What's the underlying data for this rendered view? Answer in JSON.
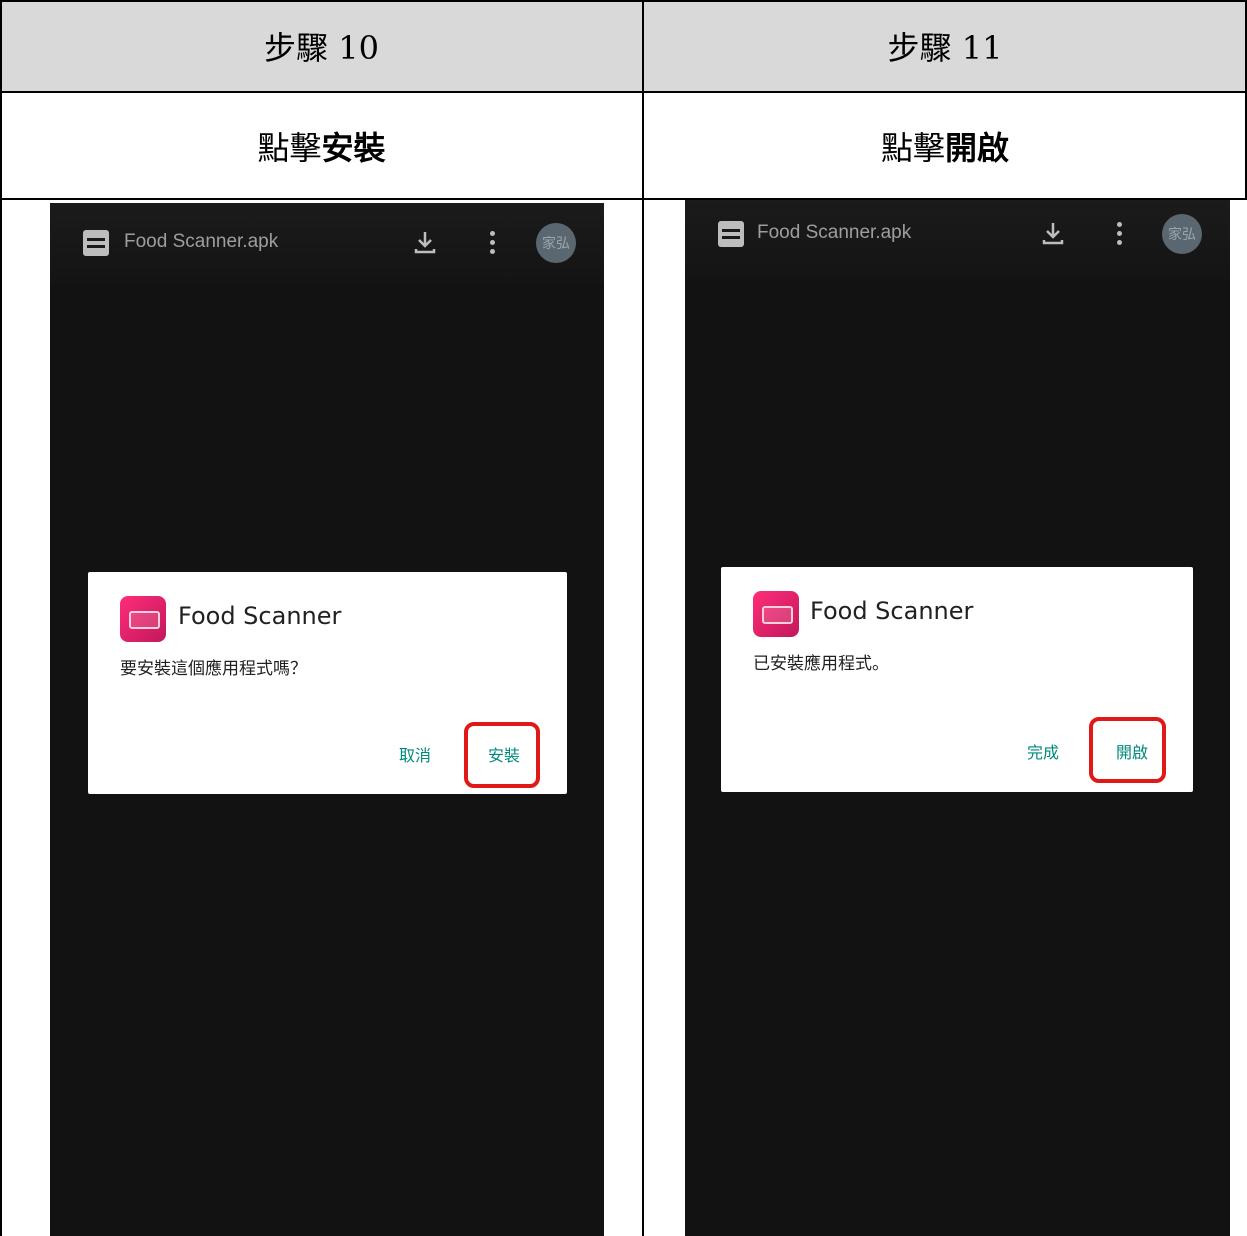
{
  "steps": [
    {
      "header": "步驟 10",
      "instruction_prefix": "點擊",
      "instruction_action": "安裝",
      "phone": {
        "file_name": "Food Scanner.apk",
        "avatar_text": "家弘",
        "app_name": "Food Scanner",
        "message": "要安裝這個應用程式嗎？",
        "secondary_button": "取消",
        "primary_button": "安裝"
      }
    },
    {
      "header": "步驟 11",
      "instruction_prefix": "點擊",
      "instruction_action": "開啟",
      "phone": {
        "file_name": "Food Scanner.apk",
        "avatar_text": "家弘",
        "app_name": "Food Scanner",
        "message": "已安裝應用程式。",
        "secondary_button": "完成",
        "primary_button": "開啟"
      }
    }
  ],
  "colors": {
    "header_bg": "#d9d9d9",
    "phone_bg": "#121212",
    "button_text": "#00897b",
    "highlight": "#e01818"
  },
  "icons": [
    "file-list-icon",
    "download-icon",
    "more-vert-icon",
    "app-icon"
  ]
}
